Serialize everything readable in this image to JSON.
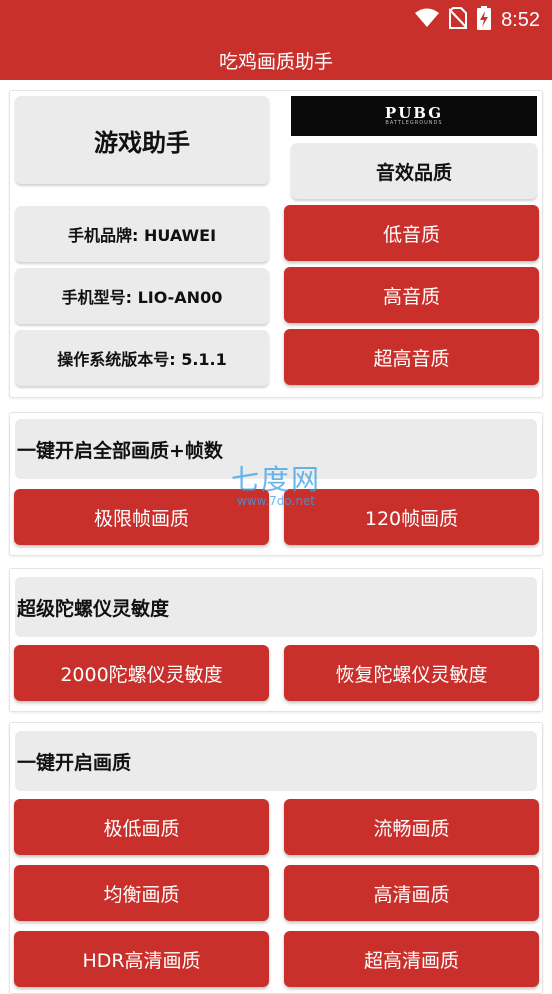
{
  "status": {
    "time": "8:52"
  },
  "app": {
    "title": "吃鸡画质助手"
  },
  "top": {
    "game_assistant": "游戏助手",
    "pubg_logo": "PUBG",
    "pubg_sub": "BATTLEGROUNDS",
    "audio_quality": "音效品质",
    "phone_brand": "手机品牌: HUAWEI",
    "phone_model": "手机型号: LIO-AN00",
    "os_version": "操作系统版本号: 5.1.1",
    "low_audio": "低音质",
    "high_audio": "高音质",
    "ultra_audio": "超高音质"
  },
  "fps_section": {
    "title": "一键开启全部画质+帧数",
    "buttons": [
      "极限帧画质",
      "120帧画质"
    ]
  },
  "gyro_section": {
    "title": "超级陀螺仪灵敏度",
    "buttons": [
      "2000陀螺仪灵敏度",
      "恢复陀螺仪灵敏度"
    ]
  },
  "quality_section": {
    "title": "一键开启画质",
    "buttons": [
      "极低画质",
      "流畅画质",
      "均衡画质",
      "高清画质",
      "HDR高清画质",
      "超高清画质"
    ]
  },
  "watermark": {
    "main": "七度网",
    "sub": "www.7do.net"
  },
  "colors": {
    "primary": "#c9302c",
    "button_gray": "#ebebeb"
  },
  "icons": {
    "wifi": "wifi-icon",
    "sim": "no-sim-icon",
    "battery": "battery-charging-icon"
  }
}
